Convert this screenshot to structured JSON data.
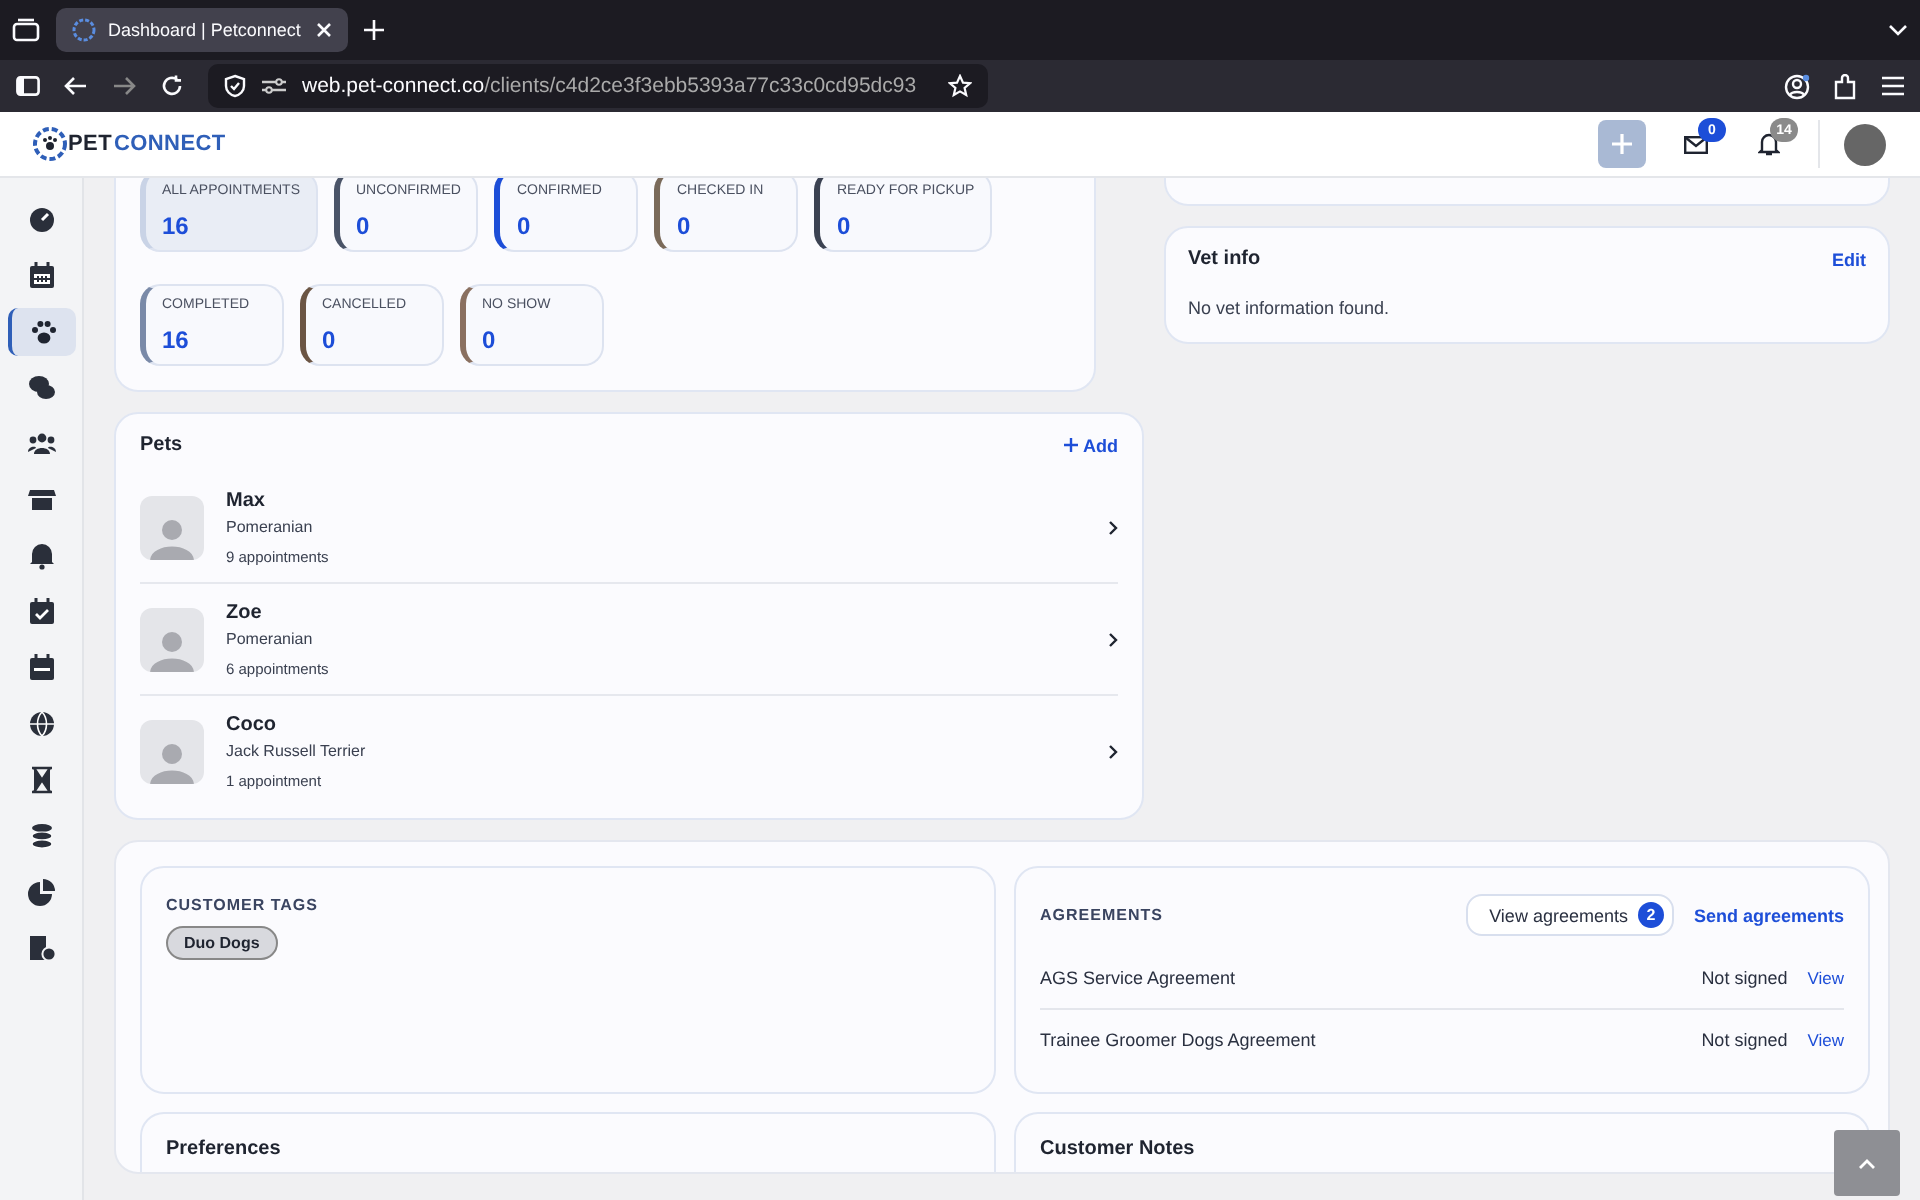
{
  "browser": {
    "tab_title": "Dashboard | Petconnect",
    "url_host": "web.pet-connect.co",
    "url_path": "/clients/c4d2ce3f3ebb5393a77c33c0cd95dc93"
  },
  "header": {
    "logo_part_1": "PET",
    "logo_part_2": "CONNECT",
    "messages_count": "0",
    "notifications_count": "14"
  },
  "sidebar": {
    "items": [
      {
        "selected": false
      },
      {
        "selected": false
      },
      {
        "selected": true
      },
      {
        "selected": false
      },
      {
        "selected": false
      },
      {
        "selected": false
      },
      {
        "selected": false
      },
      {
        "selected": false
      },
      {
        "selected": false
      },
      {
        "selected": false
      },
      {
        "selected": false
      },
      {
        "selected": false
      },
      {
        "selected": false
      },
      {
        "selected": false
      }
    ]
  },
  "appointment_filters": [
    {
      "label": "ALL APPOINTMENTS",
      "count": "16",
      "selected": true,
      "color": "#c9d3e6"
    },
    {
      "label": "UNCONFIRMED",
      "count": "0",
      "selected": false,
      "color": "#4a5468"
    },
    {
      "label": "CONFIRMED",
      "count": "0",
      "selected": false,
      "color": "#1d4ed8"
    },
    {
      "label": "CHECKED IN",
      "count": "0",
      "selected": false,
      "color": "#7a6a5a"
    },
    {
      "label": "READY FOR PICKUP",
      "count": "0",
      "selected": false,
      "color": "#3b4252"
    },
    {
      "label": "COMPLETED",
      "count": "16",
      "selected": false,
      "color": "#7a8aa8"
    },
    {
      "label": "CANCELLED",
      "count": "0",
      "selected": false,
      "color": "#6b5544"
    },
    {
      "label": "NO SHOW",
      "count": "0",
      "selected": false,
      "color": "#8a7060"
    }
  ],
  "vet_info": {
    "title": "Vet info",
    "edit": "Edit",
    "message": "No vet information found."
  },
  "pets": {
    "title": "Pets",
    "add": "Add",
    "items": [
      {
        "name": "Max",
        "breed": "Pomeranian",
        "appointments": "9 appointments"
      },
      {
        "name": "Zoe",
        "breed": "Pomeranian",
        "appointments": "6 appointments"
      },
      {
        "name": "Coco",
        "breed": "Jack Russell Terrier",
        "appointments": "1 appointment"
      }
    ]
  },
  "customer_tags": {
    "title": "CUSTOMER TAGS",
    "tags": [
      "Duo Dogs"
    ]
  },
  "agreements": {
    "title": "AGREEMENTS",
    "view_button": "View agreements",
    "view_count": "2",
    "send": "Send agreements",
    "items": [
      {
        "name": "AGS Service Agreement",
        "status": "Not signed",
        "action": "View"
      },
      {
        "name": "Trainee Groomer Dogs Agreement",
        "status": "Not signed",
        "action": "View"
      }
    ]
  },
  "preferences": {
    "title": "Preferences"
  },
  "customer_notes": {
    "title": "Customer Notes"
  }
}
